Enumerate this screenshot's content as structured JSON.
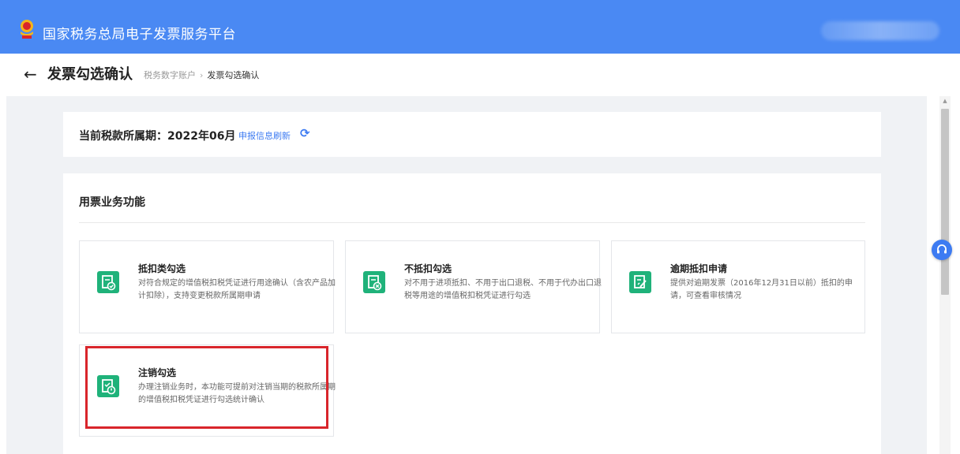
{
  "header": {
    "app_title": "国家税务总局电子发票服务平台"
  },
  "titlebar": {
    "title": "发票勾选确认",
    "breadcrumb": [
      "税务数字账户",
      "发票勾选确认"
    ],
    "breadcrumb_sep": "›"
  },
  "period": {
    "label": "当前税款所属期：2022年06月",
    "refresh_link": "申报信息刷新",
    "refresh_icon": "refresh-icon"
  },
  "functions": {
    "heading": "用票业务功能",
    "cards": [
      {
        "title": "抵扣类勾选",
        "desc": "对符合规定的增值税扣税凭证进行用途确认（含农产品加计扣除），支持变更税款所属期申请",
        "icon": "deduct-check-icon"
      },
      {
        "title": "不抵扣勾选",
        "desc": "对不用于进项抵扣、不用于出口退税、不用于代办出口退税等用途的增值税扣税凭证进行勾选",
        "icon": "no-deduct-icon"
      },
      {
        "title": "逾期抵扣申请",
        "desc": "提供对逾期发票（2016年12月31日以前）抵扣的申请，可查看审核情况",
        "icon": "overdue-apply-icon"
      },
      {
        "title": "注销勾选",
        "desc": "办理注销业务时，本功能可提前对注销当期的税款所属期的增值税扣税凭证进行勾选统计确认",
        "icon": "cancel-check-icon"
      }
    ]
  },
  "colors": {
    "header_bg": "#4a89f3",
    "accent_green": "#1fb27a",
    "link_blue": "#3d7bf2",
    "highlight_red": "#d9252b"
  }
}
